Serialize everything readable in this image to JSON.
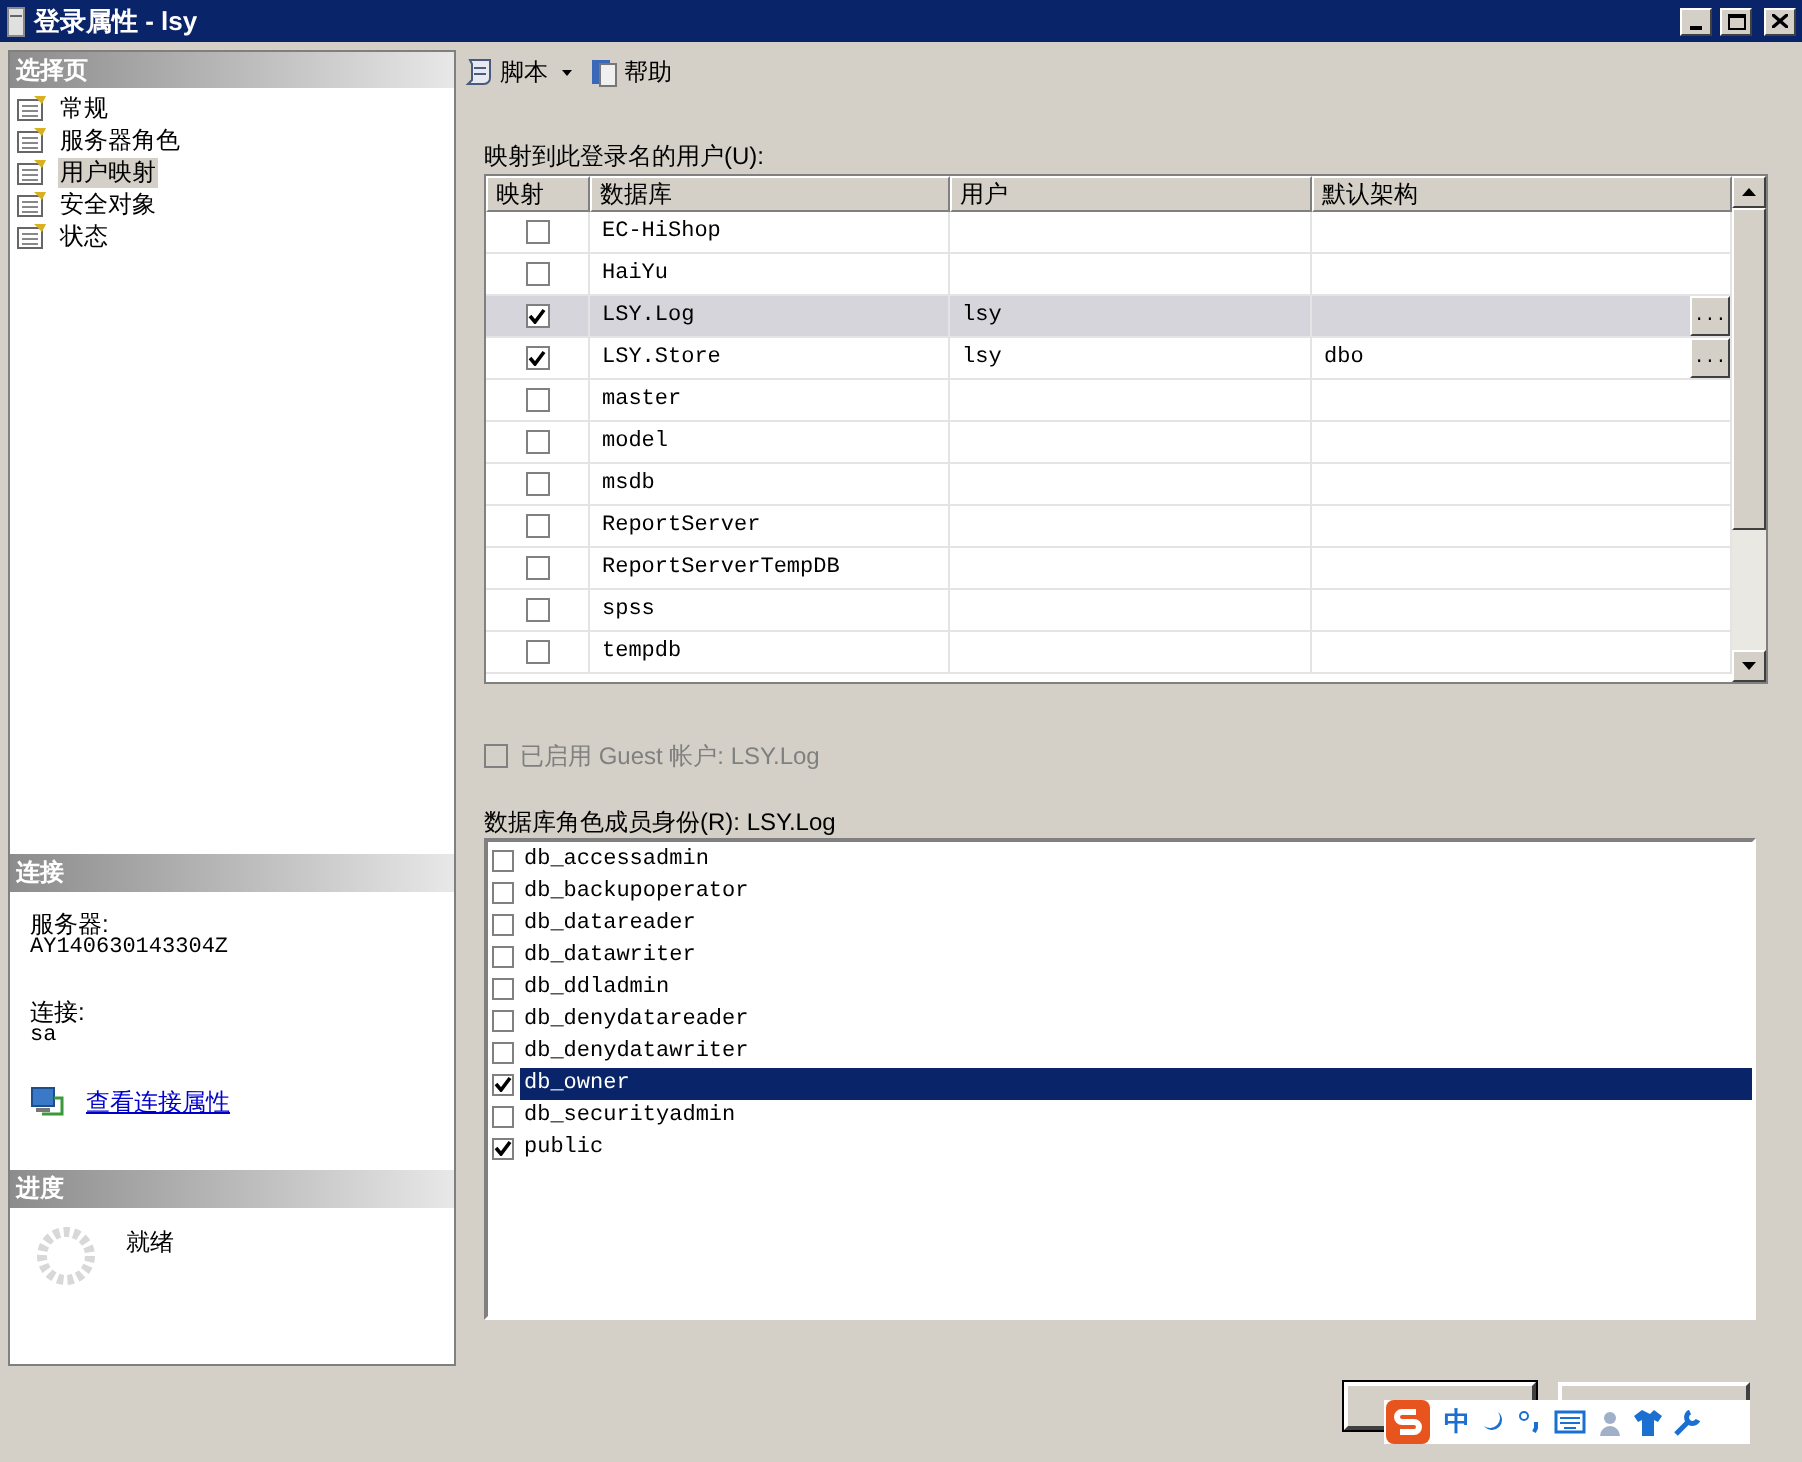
{
  "window": {
    "title": "登录属性 - lsy"
  },
  "sidebar": {
    "header": "选择页",
    "items": [
      {
        "label": "常规",
        "selected": false
      },
      {
        "label": "服务器角色",
        "selected": false
      },
      {
        "label": "用户映射",
        "selected": true
      },
      {
        "label": "安全对象",
        "selected": false
      },
      {
        "label": "状态",
        "selected": false
      }
    ]
  },
  "connection": {
    "header": "连接",
    "server_label": "服务器:",
    "server": "AY140630143304Z",
    "connection_label": "连接:",
    "connection": "sa",
    "link": "查看连接属性"
  },
  "progress": {
    "header": "进度",
    "status": "就绪"
  },
  "toolbar": [
    {
      "label": "脚本",
      "kind": "dropdown"
    },
    {
      "label": "帮助",
      "kind": "help"
    }
  ],
  "mapping": {
    "label": "映射到此登录名的用户(U):",
    "columns": [
      "映射",
      "数据库",
      "用户",
      "默认架构"
    ],
    "rows": [
      {
        "mapped": false,
        "database": "EC-HiShop",
        "selected": false
      },
      {
        "mapped": false,
        "database": "HaiYu",
        "selected": false
      },
      {
        "mapped": true,
        "database": "LSY.Log",
        "user": "lsy",
        "browse": "...",
        "selected": true
      },
      {
        "mapped": true,
        "database": "LSY.Store",
        "user": "lsy",
        "default_schema": "dbo",
        "browse": "...",
        "selected": false
      },
      {
        "mapped": false,
        "database": "master",
        "selected": false
      },
      {
        "mapped": false,
        "database": "model",
        "selected": false
      },
      {
        "mapped": false,
        "database": "msdb",
        "selected": false
      },
      {
        "mapped": false,
        "database": "ReportServer",
        "selected": false
      },
      {
        "mapped": false,
        "database": "ReportServerTempDB",
        "selected": false
      },
      {
        "mapped": false,
        "database": "spss",
        "selected": false
      },
      {
        "mapped": false,
        "database": "tempdb",
        "selected": false
      }
    ]
  },
  "guest": {
    "label": "已启用 Guest 帐户: LSY.Log",
    "checked": false,
    "disabled": true
  },
  "roles": {
    "label": "数据库角色成员身份(R): LSY.Log",
    "items": [
      {
        "name": "db_accessadmin",
        "checked": false,
        "selected": false
      },
      {
        "name": "db_backupoperator",
        "checked": false,
        "selected": false
      },
      {
        "name": "db_datareader",
        "checked": false,
        "selected": false
      },
      {
        "name": "db_datawriter",
        "checked": false,
        "selected": false
      },
      {
        "name": "db_ddladmin",
        "checked": false,
        "selected": false
      },
      {
        "name": "db_denydatareader",
        "checked": false,
        "selected": false
      },
      {
        "name": "db_denydatawriter",
        "checked": false,
        "selected": false
      },
      {
        "name": "db_owner",
        "checked": true,
        "selected": true
      },
      {
        "name": "db_securityadmin",
        "checked": false,
        "selected": false
      },
      {
        "name": "public",
        "checked": true,
        "selected": false
      }
    ]
  },
  "ime": {
    "mode": "中"
  }
}
